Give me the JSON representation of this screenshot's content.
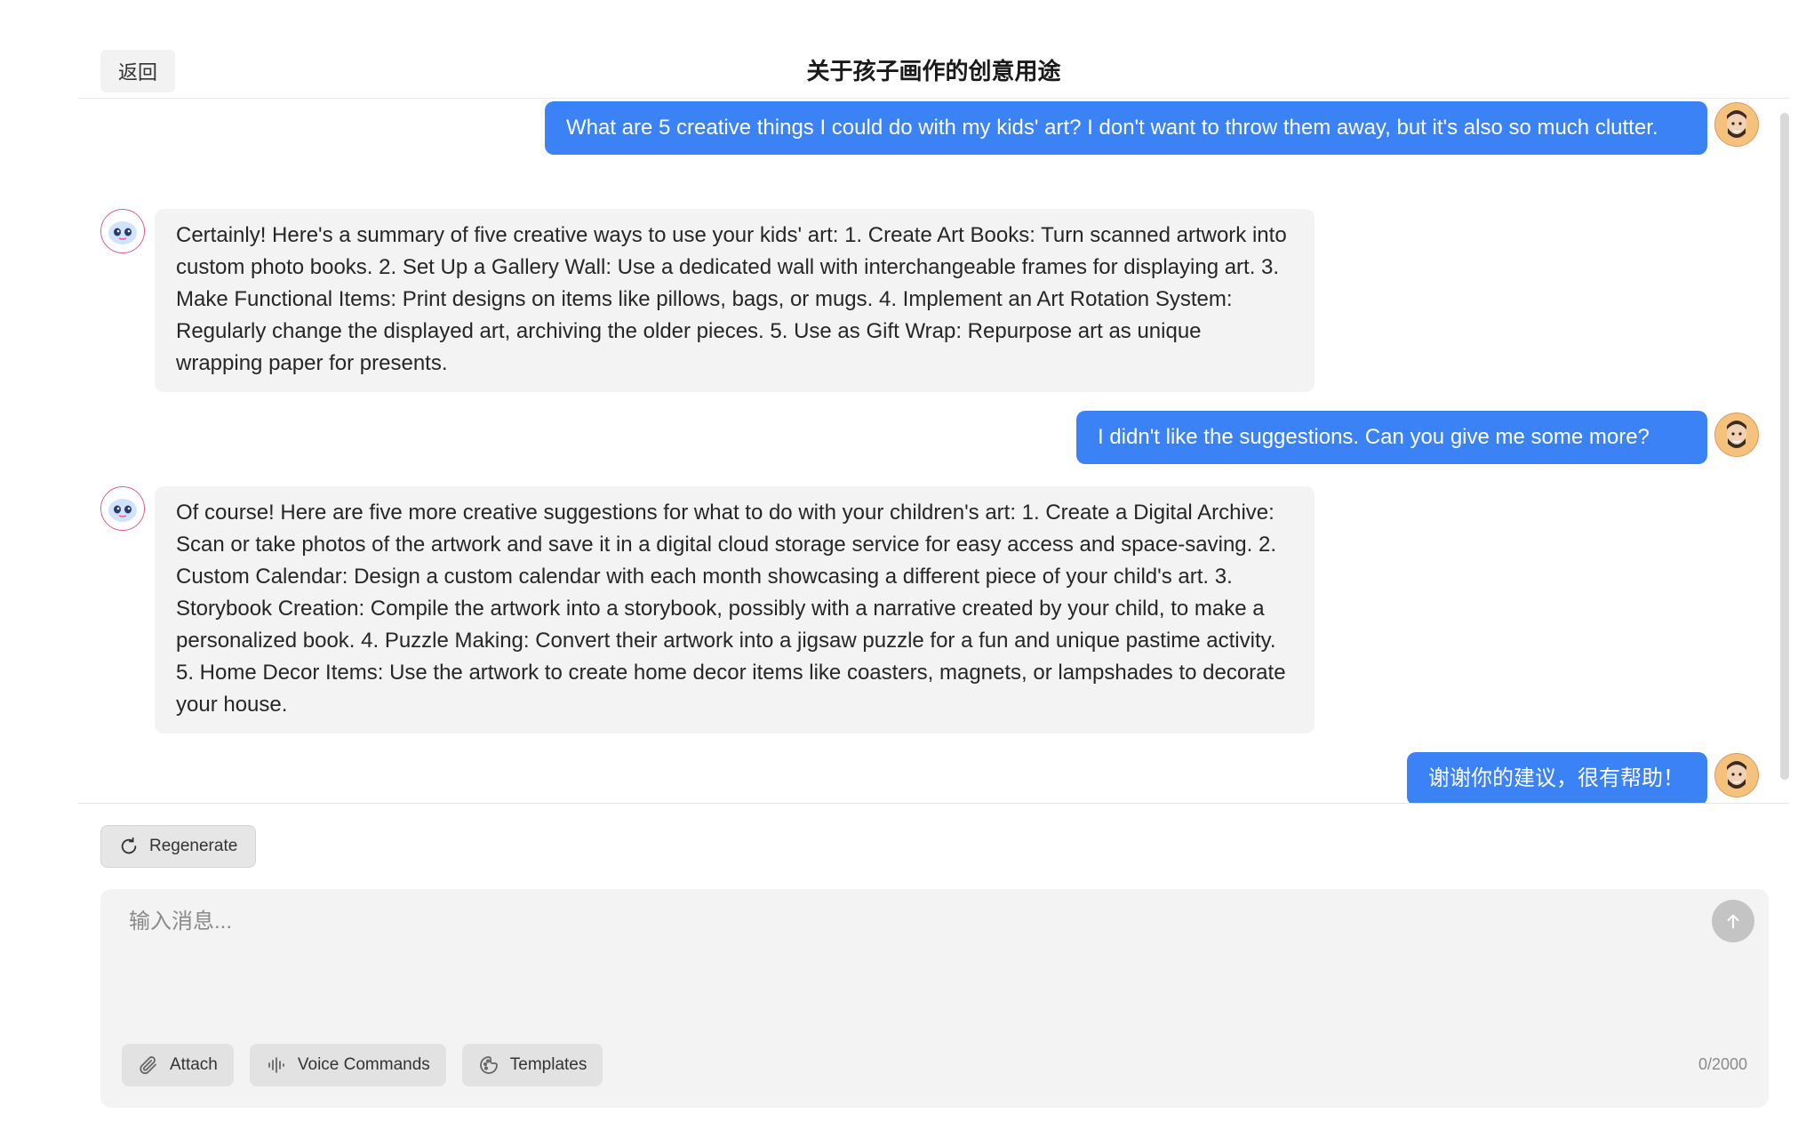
{
  "header": {
    "back_label": "返回",
    "title": "关于孩子画作的创意用途"
  },
  "messages": [
    {
      "role": "user",
      "text": "What are 5 creative things I could do with my kids' art? I don't want to throw them away, but it's also so much clutter."
    },
    {
      "role": "assistant",
      "text": "Certainly! Here's a summary of five creative ways to use your kids' art: 1. Create Art Books: Turn scanned artwork into custom photo books. 2. Set Up a Gallery Wall: Use a dedicated wall with interchangeable frames for displaying art. 3. Make Functional Items: Print designs on items like pillows, bags, or mugs. 4. Implement an Art Rotation System: Regularly change the displayed art, archiving the older pieces. 5. Use as Gift Wrap: Repurpose art as unique wrapping paper for presents."
    },
    {
      "role": "user",
      "text": "I didn't like the suggestions. Can you give me some more?"
    },
    {
      "role": "assistant",
      "text": "Of course! Here are five more creative suggestions for what to do with your children's art: 1. Create a Digital Archive: Scan or take photos of the artwork and save it in a digital cloud storage service for easy access and space-saving. 2. Custom Calendar: Design a custom calendar with each month showcasing a different piece of your child's art. 3. Storybook Creation: Compile the artwork into a storybook, possibly with a narrative created by your child, to make a personalized book. 4. Puzzle Making: Convert their artwork into a jigsaw puzzle for a fun and unique pastime activity. 5. Home Decor Items: Use the artwork to create home decor items like coasters, magnets, or lampshades to decorate your house."
    },
    {
      "role": "user",
      "text": "谢谢你的建议，很有帮助！"
    }
  ],
  "actions": {
    "regenerate_label": "Regenerate"
  },
  "composer": {
    "placeholder": "输入消息...",
    "value": "",
    "char_count": "0/2000",
    "tools": [
      {
        "label": "Attach",
        "icon": "paperclip-icon"
      },
      {
        "label": "Voice Commands",
        "icon": "waveform-icon"
      },
      {
        "label": "Templates",
        "icon": "template-icon"
      }
    ]
  },
  "colors": {
    "user_bubble": "#3b82f6",
    "bot_bubble": "#f3f3f3"
  }
}
